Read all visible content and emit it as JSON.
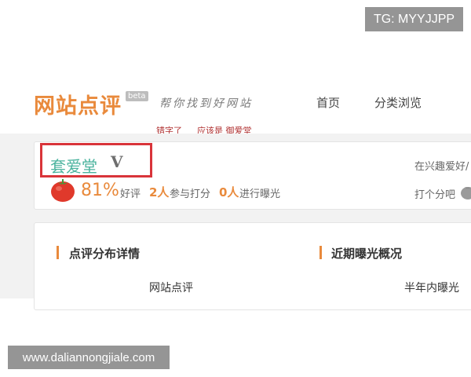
{
  "watermark_top": "TG: MYYJJPP",
  "watermark_bottom": "www.daliannongjiale.com",
  "header": {
    "logo": "网站点评",
    "beta": "beta",
    "slogan": "帮你找到好网站",
    "typo_left": "错字了",
    "typo_right": "应该是 御爱堂",
    "nav": [
      "首页",
      "分类浏览"
    ]
  },
  "site": {
    "name": "套爱堂",
    "badge": "V",
    "interest": "在兴趣爱好/"
  },
  "rating": {
    "percent": "81%",
    "percent_label": "好评",
    "raters": "2人",
    "raters_label": "参与打分",
    "exposure": "0人",
    "exposure_label": "进行曝光",
    "score_prompt": "打个分吧"
  },
  "sections": {
    "left_title": "点评分布详情",
    "left_sub": "网站点评",
    "right_title": "近期曝光概况",
    "right_sub": "半年内曝光"
  },
  "colors": {
    "accent": "#e98a3c",
    "site_name": "#4bb39e",
    "highlight_box": "#d9343a"
  }
}
